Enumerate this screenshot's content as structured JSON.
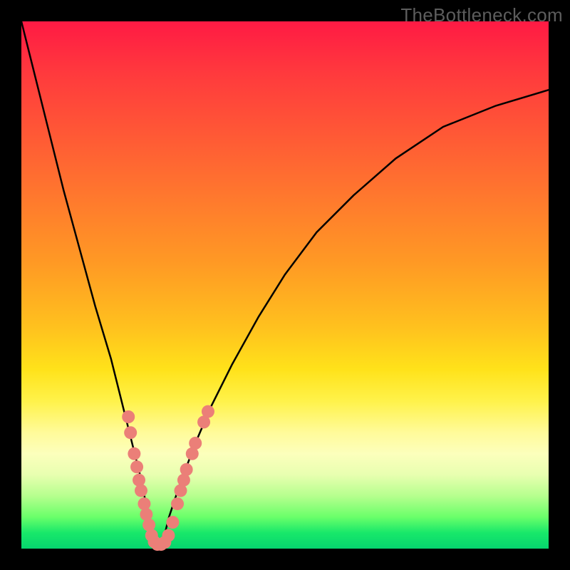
{
  "watermark": "TheBottleneck.com",
  "colors": {
    "frame": "#000000",
    "curve_stroke": "#000000",
    "dot_fill": "#eb7f78",
    "watermark_text": "#5d5d5d"
  },
  "chart_data": {
    "type": "line",
    "title": "",
    "xlabel": "",
    "ylabel": "",
    "xlim": [
      0,
      100
    ],
    "ylim": [
      0,
      100
    ],
    "grid": false,
    "legend": false,
    "note": "V-shaped bottleneck curve; y = mismatch percentage (0 at optimum). Values estimated from pixel positions.",
    "series": [
      {
        "name": "bottleneck-curve",
        "x": [
          0,
          2,
          5,
          8,
          11,
          14,
          17,
          19,
          21,
          23,
          24,
          25,
          26,
          27,
          28,
          30,
          33,
          36,
          40,
          45,
          50,
          56,
          63,
          71,
          80,
          90,
          100
        ],
        "y": [
          100,
          92,
          80,
          68,
          57,
          46,
          36,
          28,
          20,
          12,
          6,
          2,
          0,
          2,
          6,
          12,
          20,
          27,
          35,
          44,
          52,
          60,
          67,
          74,
          80,
          84,
          87
        ]
      }
    ],
    "dots": {
      "name": "sample-points",
      "note": "Clustered markers near the valley; coordinates in chart units (0-100).",
      "points": [
        {
          "x": 20.3,
          "y": 25.0
        },
        {
          "x": 20.7,
          "y": 22.0
        },
        {
          "x": 21.4,
          "y": 18.0
        },
        {
          "x": 21.9,
          "y": 15.5
        },
        {
          "x": 22.3,
          "y": 13.0
        },
        {
          "x": 22.7,
          "y": 11.0
        },
        {
          "x": 23.3,
          "y": 8.5
        },
        {
          "x": 23.7,
          "y": 6.5
        },
        {
          "x": 24.2,
          "y": 4.5
        },
        {
          "x": 24.7,
          "y": 2.5
        },
        {
          "x": 25.2,
          "y": 1.3
        },
        {
          "x": 25.8,
          "y": 0.8
        },
        {
          "x": 26.5,
          "y": 0.8
        },
        {
          "x": 27.2,
          "y": 1.2
        },
        {
          "x": 27.9,
          "y": 2.5
        },
        {
          "x": 28.7,
          "y": 5.0
        },
        {
          "x": 29.6,
          "y": 8.5
        },
        {
          "x": 30.2,
          "y": 11.0
        },
        {
          "x": 30.8,
          "y": 13.0
        },
        {
          "x": 31.3,
          "y": 15.0
        },
        {
          "x": 32.4,
          "y": 18.0
        },
        {
          "x": 33.0,
          "y": 20.0
        },
        {
          "x": 34.6,
          "y": 24.0
        },
        {
          "x": 35.4,
          "y": 26.0
        }
      ]
    }
  }
}
